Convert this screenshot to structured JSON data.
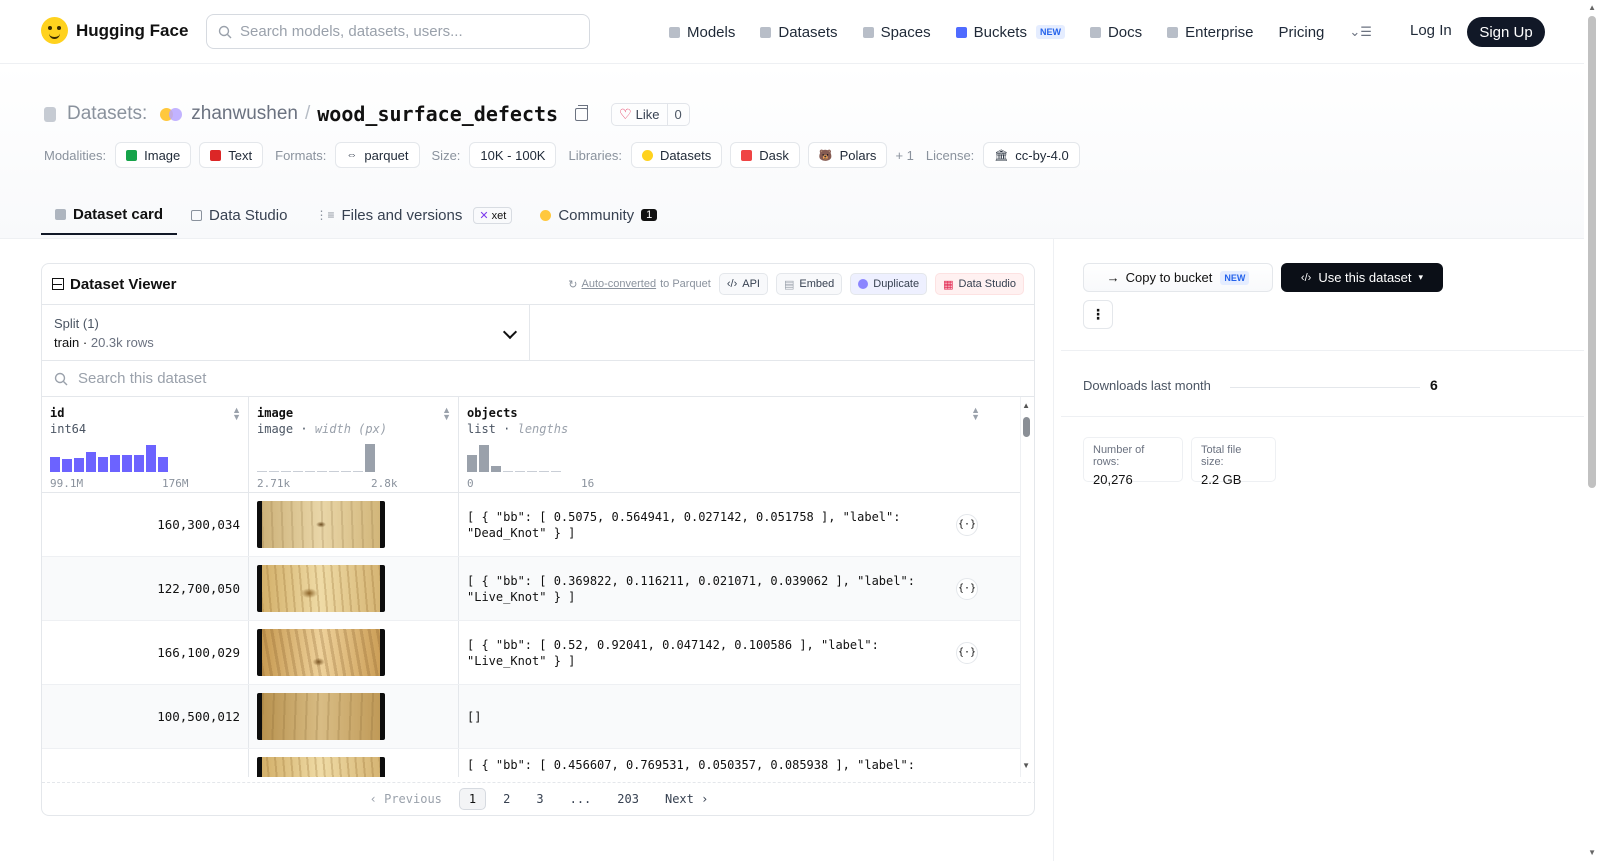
{
  "nav": {
    "brand": "Hugging Face",
    "search_placeholder": "Search models, datasets, users...",
    "items": [
      {
        "label": "Models",
        "icon": "models-icon"
      },
      {
        "label": "Datasets",
        "icon": "datasets-icon"
      },
      {
        "label": "Spaces",
        "icon": "spaces-icon"
      },
      {
        "label": "Buckets",
        "icon": "buckets-icon",
        "badge": "NEW"
      },
      {
        "label": "Docs",
        "icon": "docs-icon"
      },
      {
        "label": "Enterprise",
        "icon": "enterprise-icon"
      },
      {
        "label": "Pricing"
      }
    ],
    "login": "Log In",
    "signup": "Sign Up"
  },
  "header": {
    "section": "Datasets:",
    "user": "zhanwushen",
    "separator": "/",
    "repo": "wood_surface_defects",
    "like_label": "Like",
    "like_count": "0",
    "modalities_label": "Modalities:",
    "modalities": [
      "Image",
      "Text"
    ],
    "formats_label": "Formats:",
    "formats": [
      "parquet"
    ],
    "size_label": "Size:",
    "size": "10K - 100K",
    "libraries_label": "Libraries:",
    "libraries": [
      "Datasets",
      "Dask",
      "Polars"
    ],
    "libraries_more": "+ 1",
    "license_label": "License:",
    "license": "cc-by-4.0"
  },
  "tabs": [
    {
      "label": "Dataset card",
      "active": true
    },
    {
      "label": "Data Studio"
    },
    {
      "label": "Files and versions",
      "badge": "xet"
    },
    {
      "label": "Community",
      "count": "1"
    }
  ],
  "viewer": {
    "title": "Dataset Viewer",
    "auto_converted": "Auto-converted",
    "auto_suffix": "to Parquet",
    "buttons": [
      "API",
      "Embed",
      "Duplicate",
      "Data Studio"
    ],
    "split_label": "Split (1)",
    "split_name": "train",
    "split_rows": "20.3k rows",
    "search_placeholder": "Search this dataset",
    "columns": [
      {
        "name": "id",
        "type": "int64",
        "type_extra": "",
        "min": "99.1M",
        "max": "176M",
        "hist": [
          0.55,
          0.45,
          0.5,
          0.7,
          0.55,
          0.6,
          0.6,
          0.6,
          0.95,
          0.55
        ]
      },
      {
        "name": "image",
        "type": "image",
        "type_extra": "width (px)",
        "min": "2.71k",
        "max": "2.8k",
        "hist": [
          0.02,
          0.02,
          0.02,
          0.02,
          0.02,
          0.02,
          0.02,
          0.02,
          0.02,
          1.0
        ]
      },
      {
        "name": "objects",
        "type": "list",
        "type_extra": "lengths",
        "min": "0",
        "max": "16",
        "hist": [
          0.6,
          0.95,
          0.2,
          0.02,
          0.02,
          0.02,
          0.02,
          0.02
        ]
      }
    ],
    "rows": [
      {
        "id": "160,300,034",
        "objects": "[ { \"bb\": [ 0.5075, 0.564941, 0.027142, 0.051758 ], \"label\": \"Dead_Knot\" } ]"
      },
      {
        "id": "122,700,050",
        "objects": "[ { \"bb\": [ 0.369822, 0.116211, 0.021071, 0.039062 ], \"label\": \"Live_Knot\" } ]"
      },
      {
        "id": "166,100,029",
        "objects": "[ { \"bb\": [ 0.52, 0.92041, 0.047142, 0.100586 ], \"label\": \"Live_Knot\" } ]"
      },
      {
        "id": "100,500,012",
        "objects": "[]"
      },
      {
        "id": "",
        "objects": "[ { \"bb\": [ 0.456607, 0.769531, 0.050357, 0.085938 ], \"label\":"
      }
    ],
    "pager": {
      "prev": "Previous",
      "pages": [
        "1",
        "2",
        "3",
        "...",
        "203"
      ],
      "next": "Next"
    }
  },
  "sidebar": {
    "copy_bucket": "Copy to bucket",
    "copy_badge": "NEW",
    "use_dataset": "Use this dataset",
    "downloads_label": "Downloads last month",
    "downloads_value": "6",
    "rows_label": "Number of rows:",
    "rows_value": "20,276",
    "size_label": "Total file size:",
    "size_value": "2.2 GB"
  },
  "colors": {
    "accent": "#6c63ff",
    "hist_gray": "#9aa1ab",
    "brand_yellow": "#ffd21e"
  }
}
